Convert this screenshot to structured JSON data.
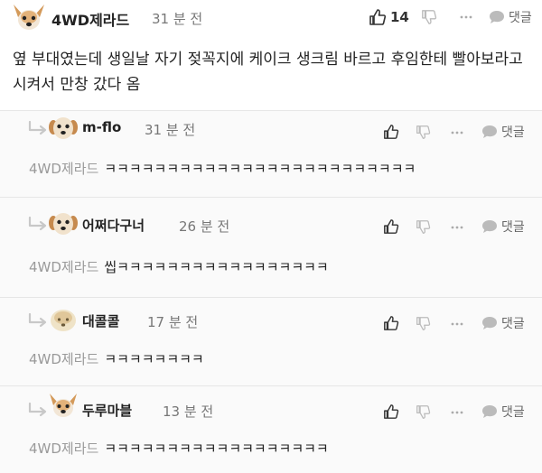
{
  "post": {
    "author": "4WD제라드",
    "time": "31 분 전",
    "likes": "14",
    "reply_label": "댓글",
    "text": "옆 부대였는데 생일날 자기 젖꼭지에 케이크 생크림 바르고 후임한테 빨아보라고 시켜서 만창 갔다 옴"
  },
  "replies": [
    {
      "author": "m-flo",
      "time": "31 분 전",
      "mention": "4WD제라드",
      "text": "ㅋㅋㅋㅋㅋㅋㅋㅋㅋㅋㅋㅋㅋㅋㅋㅋㅋㅋㅋㅋㅋㅋㅋㅋㅋ",
      "reply_label": "댓글"
    },
    {
      "author": "어쩌다구너",
      "time": "26 분 전",
      "mention": "4WD제라드",
      "text": "씹ㅋㅋㅋㅋㅋㅋㅋㅋㅋㅋㅋㅋㅋㅋㅋㅋㅋ",
      "reply_label": "댓글"
    },
    {
      "author": "대콜콜",
      "time": "17 분 전",
      "mention": "4WD제라드",
      "text": "ㅋㅋㅋㅋㅋㅋㅋㅋ",
      "reply_label": "댓글"
    },
    {
      "author": "두루마블",
      "time": "13 분 전",
      "mention": "4WD제라드",
      "text": "ㅋㅋㅋㅋㅋㅋㅋㅋㅋㅋㅋㅋㅋㅋㅋㅋㅋㅋ",
      "reply_label": "댓글"
    }
  ],
  "icons": {
    "like": "thumbs-up-icon",
    "dislike": "thumbs-down-icon",
    "more": "more-dots-icon",
    "reply": "speech-bubble-icon",
    "avatar": "dog-avatar-icon",
    "reply_arrow": "reply-arrow-icon"
  }
}
